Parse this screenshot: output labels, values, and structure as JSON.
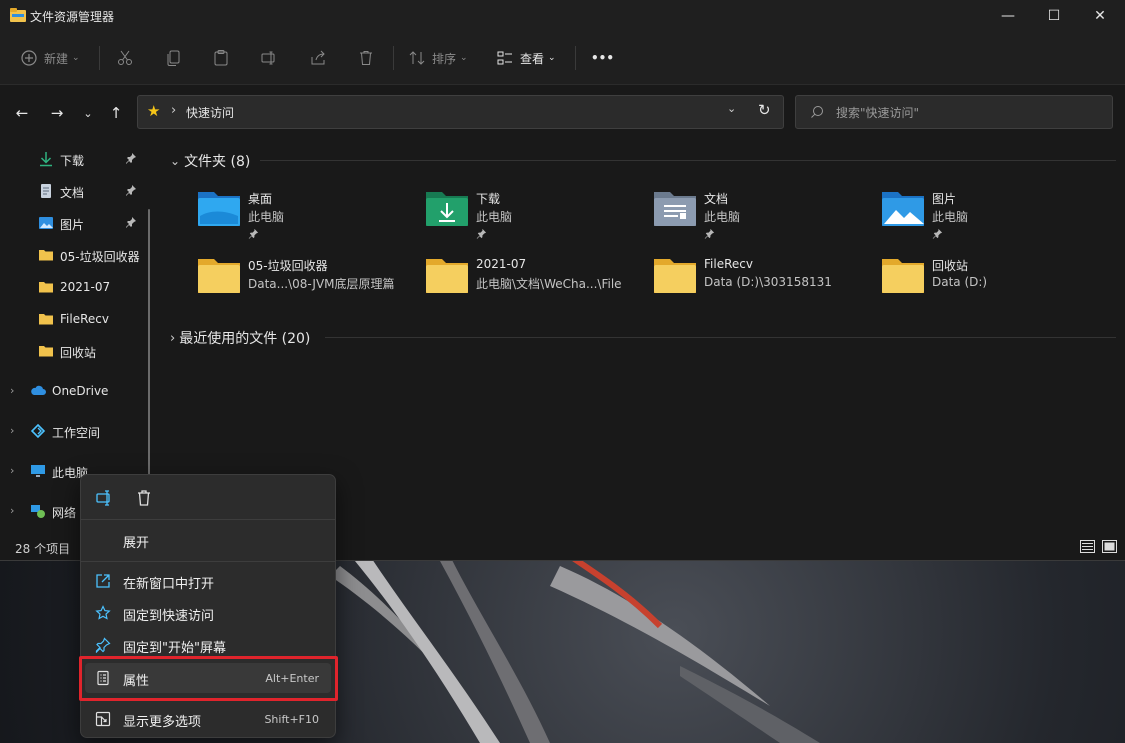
{
  "window": {
    "title": "文件资源管理器",
    "controls": {
      "minimize": "—",
      "maximize": "☐",
      "close": "✕"
    }
  },
  "toolbar": {
    "new_label": "新建",
    "sort_label": "排序",
    "view_label": "查看",
    "more_label": "•••"
  },
  "address": {
    "path_separator": "›",
    "location": "快速访问",
    "search_placeholder": "搜索\"快速访问\""
  },
  "sidebar": {
    "pinned": [
      {
        "label": "下载",
        "pinned": true
      },
      {
        "label": "文档",
        "pinned": true
      },
      {
        "label": "图片",
        "pinned": true
      },
      {
        "label": "05-垃圾回收器",
        "pinned": false
      },
      {
        "label": "2021-07",
        "pinned": false
      },
      {
        "label": "FileRecv",
        "pinned": false
      },
      {
        "label": "回收站",
        "pinned": false
      }
    ],
    "roots": [
      {
        "label": "OneDrive"
      },
      {
        "label": "工作空间"
      },
      {
        "label": "此电脑"
      },
      {
        "label": "网络"
      }
    ]
  },
  "content": {
    "folders_header": "文件夹 (8)",
    "recent_header": "最近使用的文件 (20)",
    "folders": [
      {
        "name": "桌面",
        "sub": "此电脑",
        "pinned": true,
        "icon": "desktop-folder-icon",
        "color": "#2f8fe0"
      },
      {
        "name": "下载",
        "sub": "此电脑",
        "pinned": true,
        "icon": "downloads-folder-icon",
        "color": "#22a06b"
      },
      {
        "name": "文档",
        "sub": "此电脑",
        "pinned": true,
        "icon": "documents-folder-icon",
        "color": "#8c9bb0"
      },
      {
        "name": "图片",
        "sub": "此电脑",
        "pinned": true,
        "icon": "pictures-folder-icon",
        "color": "#2f9ae6"
      },
      {
        "name": "05-垃圾回收器",
        "sub": "Data...\\08-JVM底层原理篇",
        "pinned": false,
        "icon": "folder-icon",
        "color": "#f1c24c"
      },
      {
        "name": "2021-07",
        "sub": "此电脑\\文档\\WeCha...\\File",
        "pinned": false,
        "icon": "folder-icon",
        "color": "#f1c24c"
      },
      {
        "name": "FileRecv",
        "sub": "Data (D:)\\303158131",
        "pinned": false,
        "icon": "folder-icon",
        "color": "#f1c24c"
      },
      {
        "name": "回收站",
        "sub": "Data (D:)",
        "pinned": false,
        "icon": "folder-icon",
        "color": "#f1c24c"
      }
    ]
  },
  "status": {
    "item_count": "28 个项目"
  },
  "context_menu": {
    "expand": "展开",
    "items": [
      {
        "label": "在新窗口中打开",
        "shortcut": "",
        "icon": "open-new-window-icon"
      },
      {
        "label": "固定到快速访问",
        "shortcut": "",
        "icon": "star-icon"
      },
      {
        "label": "固定到\"开始\"屏幕",
        "shortcut": "",
        "icon": "pin-icon"
      },
      {
        "label": "属性",
        "shortcut": "Alt+Enter",
        "icon": "properties-icon"
      },
      {
        "label": "显示更多选项",
        "shortcut": "Shift+F10",
        "icon": "more-options-icon"
      }
    ]
  },
  "colors": {
    "accent_blue": "#4cc2ff",
    "folder_yellow": "#f1c24c",
    "highlight_red": "#e0242c"
  }
}
